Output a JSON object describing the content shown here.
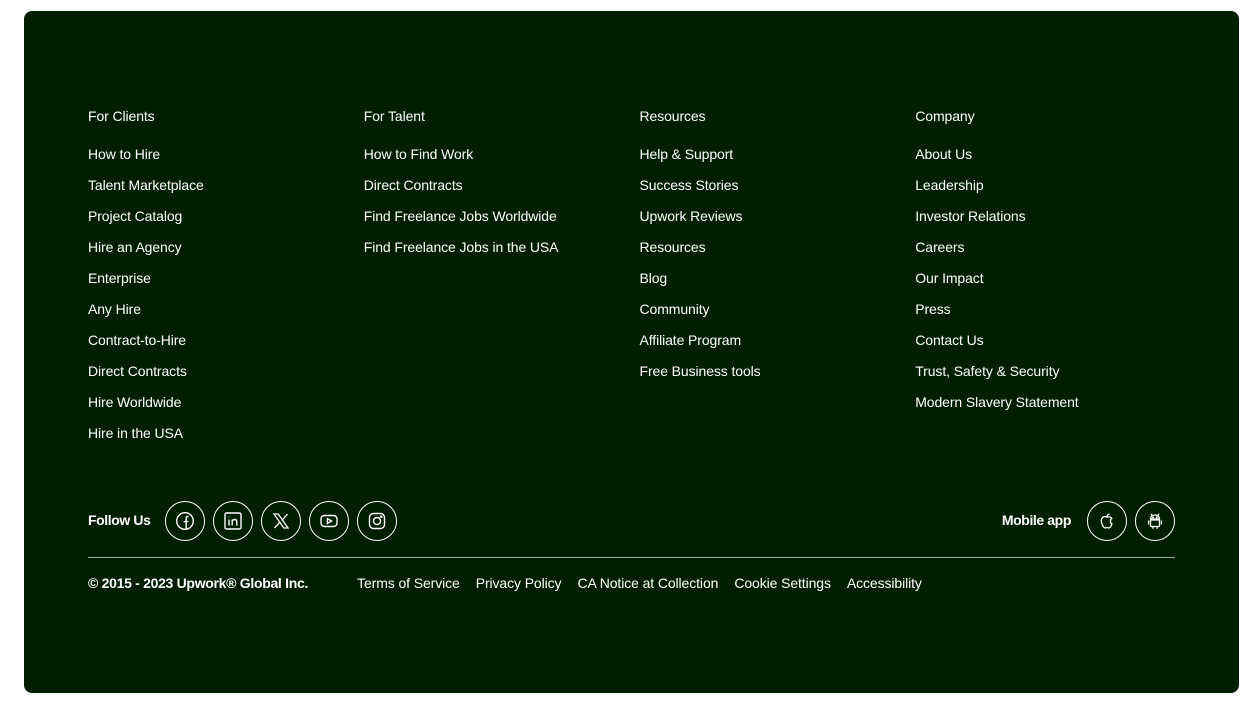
{
  "columns": [
    {
      "heading": "For Clients",
      "links": [
        "How to Hire",
        "Talent Marketplace",
        "Project Catalog",
        "Hire an Agency",
        "Enterprise",
        "Any Hire",
        "Contract-to-Hire",
        "Direct Contracts",
        "Hire Worldwide",
        "Hire in the USA"
      ]
    },
    {
      "heading": "For Talent",
      "links": [
        "How to Find Work",
        "Direct Contracts",
        "Find Freelance Jobs Worldwide",
        "Find Freelance Jobs in the USA"
      ]
    },
    {
      "heading": "Resources",
      "links": [
        "Help & Support",
        "Success Stories",
        "Upwork Reviews",
        "Resources",
        "Blog",
        "Community",
        "Affiliate Program",
        "Free Business tools"
      ]
    },
    {
      "heading": "Company",
      "links": [
        "About Us",
        "Leadership",
        "Investor Relations",
        "Careers",
        "Our Impact",
        "Press",
        "Contact Us",
        "Trust, Safety & Security",
        "Modern Slavery Statement"
      ]
    }
  ],
  "social": {
    "label": "Follow Us",
    "icons": [
      "facebook-icon",
      "linkedin-icon",
      "x-twitter-icon",
      "youtube-icon",
      "instagram-icon"
    ]
  },
  "mobile": {
    "label": "Mobile app",
    "icons": [
      "apple-icon",
      "android-icon"
    ]
  },
  "bottom": {
    "copyright": "© 2015 - 2023 Upwork® Global Inc.",
    "links": [
      "Terms of Service",
      "Privacy Policy",
      "CA Notice at Collection",
      "Cookie Settings",
      "Accessibility"
    ]
  },
  "colors": {
    "background": "#001e00",
    "text": "#ffffff"
  }
}
